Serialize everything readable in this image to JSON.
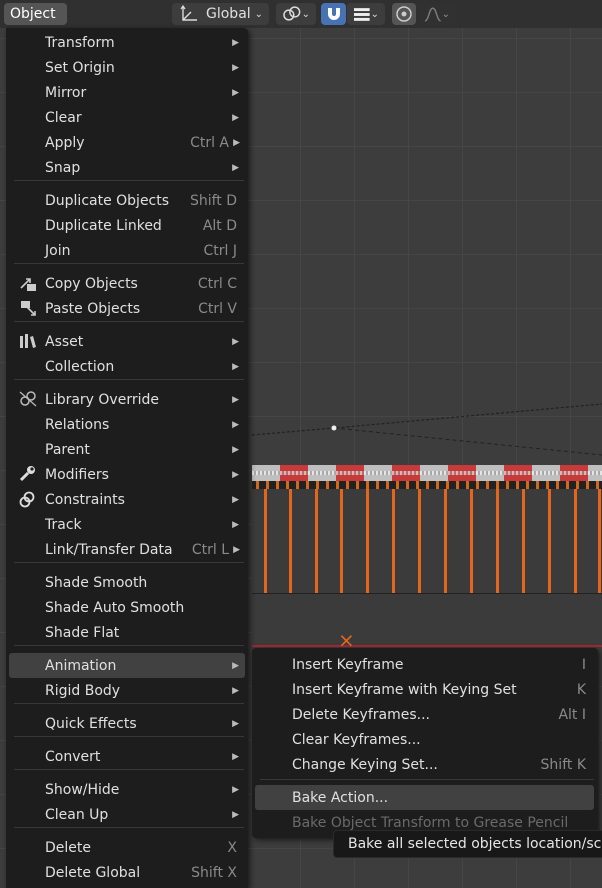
{
  "header": {
    "object_menu_label": "Object",
    "transform_orientation_label": "Global"
  },
  "colors": {
    "accent_blue": "#4772b3",
    "orange": "#e2661d",
    "menu_bg": "#1d1d1d"
  },
  "menu": {
    "items": [
      {
        "label": "Transform",
        "shortcut": "",
        "submenu": true
      },
      {
        "label": "Set Origin",
        "shortcut": "",
        "submenu": true
      },
      {
        "label": "Mirror",
        "shortcut": "",
        "submenu": true
      },
      {
        "label": "Clear",
        "shortcut": "",
        "submenu": true
      },
      {
        "label": "Apply",
        "shortcut": "Ctrl A",
        "submenu": true
      },
      {
        "label": "Snap",
        "shortcut": "",
        "submenu": true
      },
      {
        "label": "Duplicate Objects",
        "shortcut": "Shift D",
        "submenu": false
      },
      {
        "label": "Duplicate Linked",
        "shortcut": "Alt D",
        "submenu": false
      },
      {
        "label": "Join",
        "shortcut": "Ctrl J",
        "submenu": false
      },
      {
        "label": "Copy Objects",
        "shortcut": "Ctrl C",
        "submenu": false,
        "icon": "copy-icon"
      },
      {
        "label": "Paste Objects",
        "shortcut": "Ctrl V",
        "submenu": false,
        "icon": "paste-icon"
      },
      {
        "label": "Asset",
        "shortcut": "",
        "submenu": true,
        "icon": "asset-icon"
      },
      {
        "label": "Collection",
        "shortcut": "",
        "submenu": true
      },
      {
        "label": "Library Override",
        "shortcut": "",
        "submenu": true,
        "icon": "library-override-icon"
      },
      {
        "label": "Relations",
        "shortcut": "",
        "submenu": true
      },
      {
        "label": "Parent",
        "shortcut": "",
        "submenu": true
      },
      {
        "label": "Modifiers",
        "shortcut": "",
        "submenu": true,
        "icon": "wrench-icon"
      },
      {
        "label": "Constraints",
        "shortcut": "",
        "submenu": true,
        "icon": "constraint-icon"
      },
      {
        "label": "Track",
        "shortcut": "",
        "submenu": true
      },
      {
        "label": "Link/Transfer Data",
        "shortcut": "Ctrl L",
        "submenu": true
      },
      {
        "label": "Shade Smooth",
        "shortcut": "",
        "submenu": false
      },
      {
        "label": "Shade Auto Smooth",
        "shortcut": "",
        "submenu": false
      },
      {
        "label": "Shade Flat",
        "shortcut": "",
        "submenu": false
      },
      {
        "label": "Animation",
        "shortcut": "",
        "submenu": true
      },
      {
        "label": "Rigid Body",
        "shortcut": "",
        "submenu": true
      },
      {
        "label": "Quick Effects",
        "shortcut": "",
        "submenu": true
      },
      {
        "label": "Convert",
        "shortcut": "",
        "submenu": true
      },
      {
        "label": "Show/Hide",
        "shortcut": "",
        "submenu": true
      },
      {
        "label": "Clean Up",
        "shortcut": "",
        "submenu": true
      },
      {
        "label": "Delete",
        "shortcut": "X",
        "submenu": false
      },
      {
        "label": "Delete Global",
        "shortcut": "Shift X",
        "submenu": false
      }
    ]
  },
  "animation_submenu": {
    "items": [
      {
        "label": "Insert Keyframe",
        "shortcut": "I"
      },
      {
        "label": "Insert Keyframe with Keying Set",
        "shortcut": "K"
      },
      {
        "label": "Delete Keyframes...",
        "shortcut": "Alt I"
      },
      {
        "label": "Clear Keyframes...",
        "shortcut": ""
      },
      {
        "label": "Change Keying Set...",
        "shortcut": "Shift K"
      },
      {
        "label": "Bake Action...",
        "shortcut": ""
      },
      {
        "label": "Bake Object Transform to Grease Pencil",
        "shortcut": ""
      }
    ]
  },
  "tooltip": {
    "text": "Bake all selected objects location/scale"
  }
}
